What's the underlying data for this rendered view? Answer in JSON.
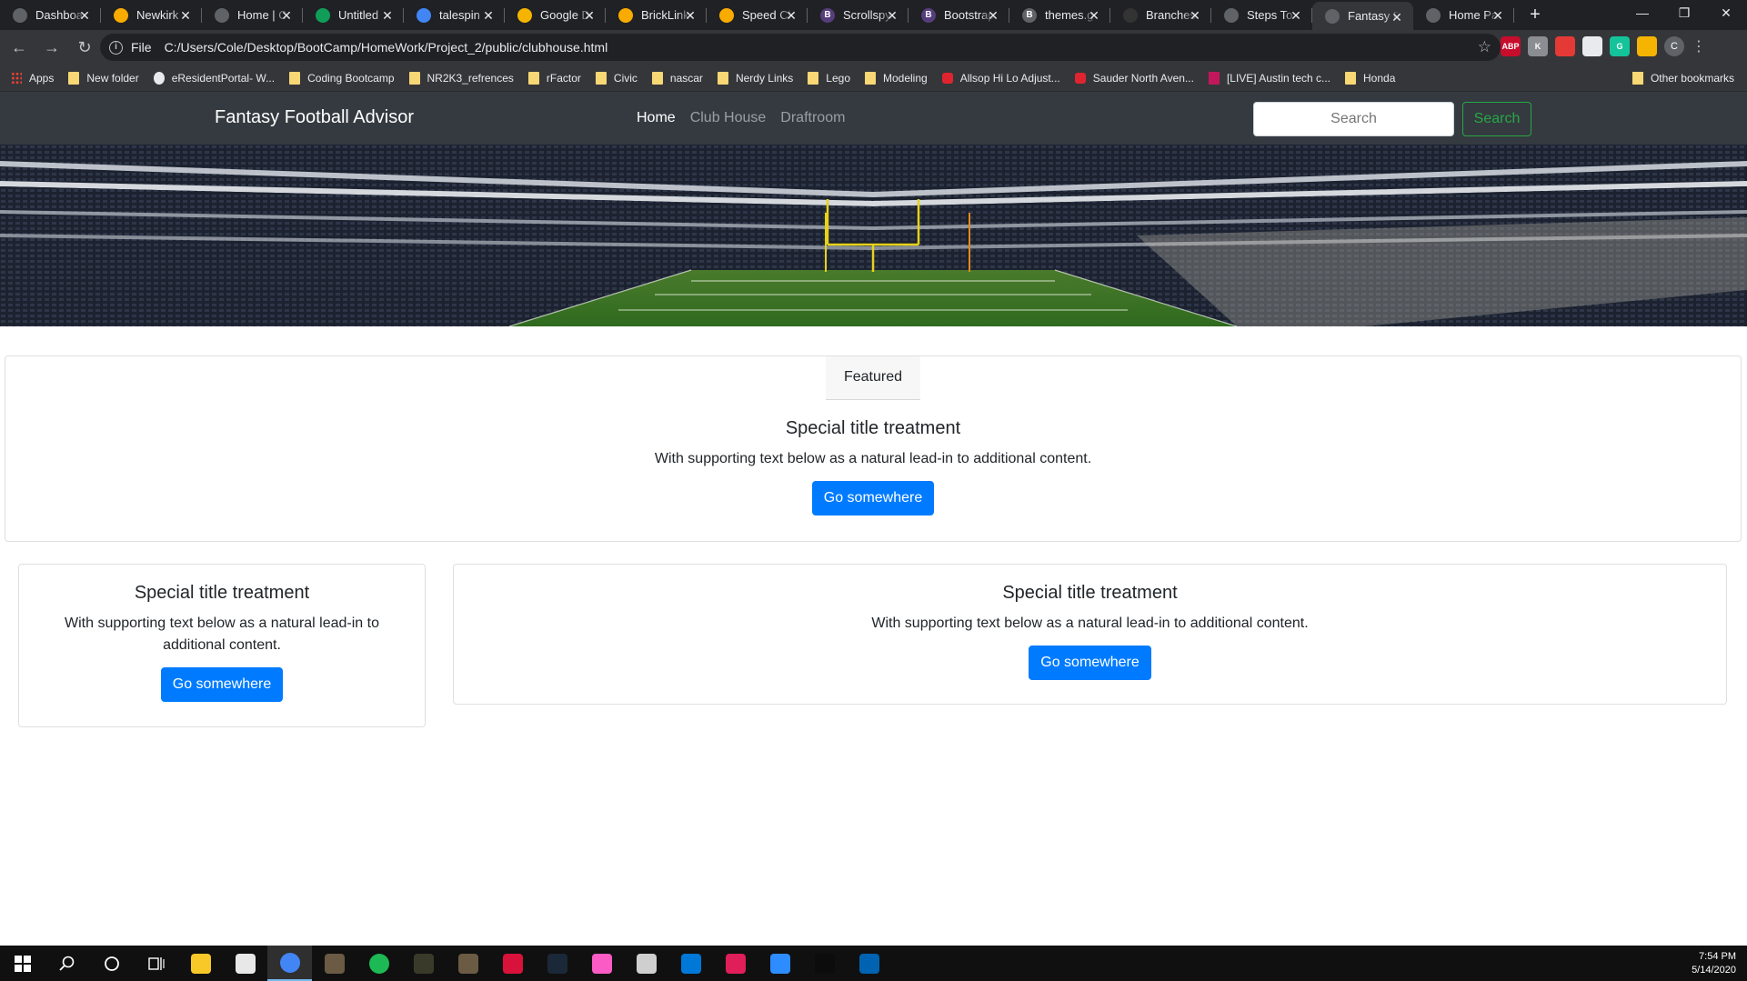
{
  "browser": {
    "tabs": [
      {
        "title": "Dashboa",
        "favicon": "globe-icon",
        "color": "#5f6368"
      },
      {
        "title": "Newkirk",
        "favicon": "hexagon-icon",
        "color": "#f9ab00"
      },
      {
        "title": "Home | C",
        "favicon": "globe-icon",
        "color": "#5f6368"
      },
      {
        "title": "Untitled",
        "favicon": "sheets-icon",
        "color": "#0f9d58"
      },
      {
        "title": "talespin",
        "favicon": "google-icon",
        "color": "#4285f4"
      },
      {
        "title": "Google D",
        "favicon": "drive-icon",
        "color": "#f4b400"
      },
      {
        "title": "BrickLink",
        "favicon": "hexagon-icon",
        "color": "#f9ab00"
      },
      {
        "title": "Speed Cl",
        "favicon": "hexagon-icon",
        "color": "#f9ab00"
      },
      {
        "title": "Scrollspy",
        "favicon": "bootstrap-icon",
        "color": "#563d7c",
        "letter": "B"
      },
      {
        "title": "Bootstrap",
        "favicon": "bootstrap-icon",
        "color": "#563d7c",
        "letter": "B"
      },
      {
        "title": "themes.g",
        "favicon": "bootstrap-icon",
        "color": "#5f6368",
        "letter": "B"
      },
      {
        "title": "Branches",
        "favicon": "github-icon",
        "color": "#333333"
      },
      {
        "title": "Steps To",
        "favicon": "globe-icon",
        "color": "#5f6368"
      },
      {
        "title": "Fantasy F",
        "favicon": "globe-icon",
        "color": "#5f6368",
        "active": true
      },
      {
        "title": "Home Pa",
        "favicon": "globe-icon",
        "color": "#5f6368"
      }
    ],
    "new_tab": "+",
    "address": {
      "scheme": "File",
      "url": "C:/Users/Cole/Desktop/BootCamp/HomeWork/Project_2/public/clubhouse.html"
    },
    "profile_initial": "C",
    "extensions": [
      {
        "label": "ABP",
        "color": "#c70d2c"
      },
      {
        "label": "K",
        "color": "#8a8d91"
      },
      {
        "label": "",
        "color": "#e53935"
      },
      {
        "label": "",
        "color": "#e8eaed"
      },
      {
        "label": "G",
        "color": "#15c39a"
      },
      {
        "label": "",
        "color": "#f4b400"
      }
    ],
    "bookmarks": [
      {
        "label": "Apps",
        "icon": "apps"
      },
      {
        "label": "New folder",
        "icon": "folder"
      },
      {
        "label": "eResidentPortal- W...",
        "icon": "round"
      },
      {
        "label": "Coding Bootcamp",
        "icon": "folder"
      },
      {
        "label": "NR2K3_refrences",
        "icon": "folder"
      },
      {
        "label": "rFactor",
        "icon": "folder"
      },
      {
        "label": "Civic",
        "icon": "folder"
      },
      {
        "label": "nascar",
        "icon": "folder"
      },
      {
        "label": "Nerdy Links",
        "icon": "folder"
      },
      {
        "label": "Lego",
        "icon": "folder"
      },
      {
        "label": "Modeling",
        "icon": "folder"
      },
      {
        "label": "Allsop Hi Lo Adjust...",
        "icon": "red"
      },
      {
        "label": "Sauder North Aven...",
        "icon": "red"
      },
      {
        "label": "[LIVE] Austin tech c...",
        "icon": "mk"
      },
      {
        "label": "Honda",
        "icon": "folder"
      }
    ],
    "other_bookmarks": "Other bookmarks"
  },
  "site": {
    "brand": "Fantasy Football Advisor",
    "nav": {
      "home": "Home",
      "clubhouse": "Club House",
      "draftroom": "Draftroom"
    },
    "search_placeholder": "Search",
    "search_button": "Search"
  },
  "featured_card": {
    "header": "Featured",
    "title": "Special title treatment",
    "text": "With supporting text below as a natural lead-in to additional content.",
    "button": "Go somewhere"
  },
  "left_card": {
    "title": "Special title treatment",
    "text": "With supporting text below as a natural lead-in to additional content.",
    "button": "Go somewhere"
  },
  "right_card": {
    "title": "Special title treatment",
    "text": "With supporting text below as a natural lead-in to additional content.",
    "button": "Go somewhere"
  },
  "taskbar": {
    "apps": [
      {
        "name": "file-explorer-icon",
        "color": "#f8c829"
      },
      {
        "name": "store-icon",
        "color": "#e8e8e8"
      },
      {
        "name": "chrome-icon",
        "color": "#4285f4",
        "active": true
      },
      {
        "name": "app-icon",
        "color": "#6b5a44"
      },
      {
        "name": "spotify-icon",
        "color": "#1db954"
      },
      {
        "name": "app-icon",
        "color": "#3a3a2a"
      },
      {
        "name": "app-icon",
        "color": "#6b5a44"
      },
      {
        "name": "app-icon",
        "color": "#d8123a"
      },
      {
        "name": "steam-icon",
        "color": "#1b2838"
      },
      {
        "name": "itunes-icon",
        "color": "#fb5bc5"
      },
      {
        "name": "app-icon",
        "color": "#cfcfcf"
      },
      {
        "name": "vscode-icon",
        "color": "#0078d7"
      },
      {
        "name": "slack-icon",
        "color": "#e01e5a"
      },
      {
        "name": "zoom-icon",
        "color": "#2d8cff"
      },
      {
        "name": "terminal-icon",
        "color": "#0c0c0c"
      },
      {
        "name": "photos-icon",
        "color": "#0063b1"
      }
    ],
    "time": "7:54 PM",
    "date": "5/14/2020"
  }
}
